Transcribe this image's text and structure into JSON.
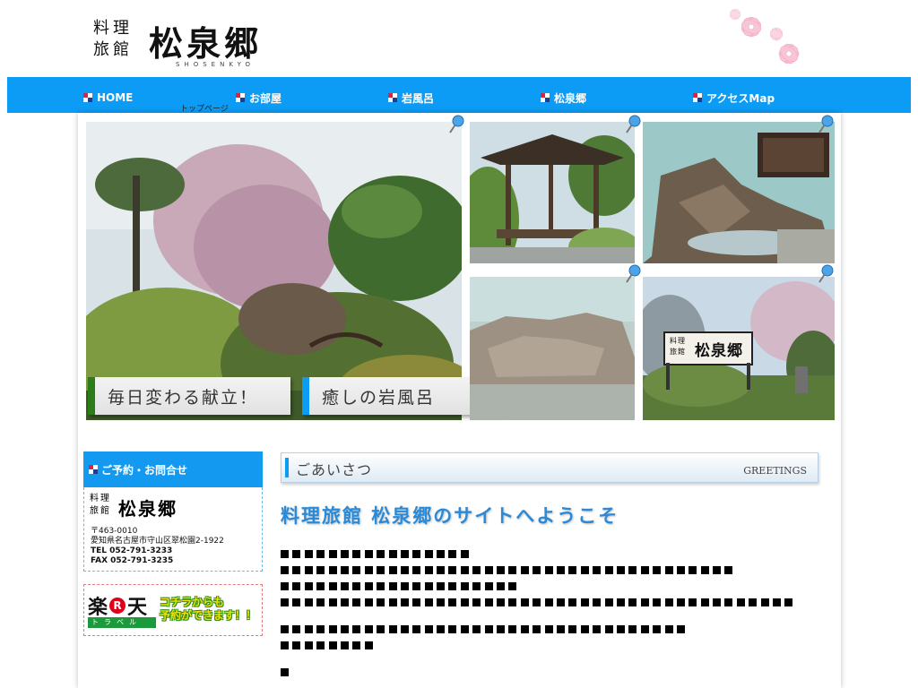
{
  "header": {
    "logo_small": "料理旅館",
    "logo_name": "松泉郷",
    "logo_roman": "SHOSENKYO"
  },
  "nav": {
    "items": [
      {
        "label": "HOME",
        "sub": "トップページ"
      },
      {
        "label": "お部屋"
      },
      {
        "label": "岩風呂"
      },
      {
        "label": "松泉郷"
      },
      {
        "label": "アクセスMap"
      }
    ]
  },
  "gallery": {
    "captions": [
      "毎日変わる献立！",
      "癒しの岩風呂"
    ],
    "caption_colors": [
      "#2c7d1a",
      "#0d9cf5"
    ],
    "sign_text": {
      "small": "料理旅館",
      "name": "松泉郷"
    }
  },
  "sidebar": {
    "heading": "ご予約・お問合せ",
    "logo_small": "料理旅館",
    "logo_name": "松泉郷",
    "postal": "〒463-0010",
    "address": "愛知県名古屋市守山区翠松園2-1922",
    "tel": "TEL  052-791-3233",
    "fax": "FAX  052-791-3235",
    "rakuten": {
      "brand_left": "楽",
      "brand_mark": "R",
      "brand_right": "天",
      "brand_sub": "トラベル",
      "line1": "コチラからも",
      "line2": "予約ができます！！"
    }
  },
  "greetings": {
    "title": "ごあいさつ",
    "title_en": "GREETINGS",
    "welcome": "料理旅館 松泉郷のサイトへようこそ",
    "censored_lines": [
      16,
      38,
      20,
      43,
      34,
      8,
      1
    ]
  },
  "colors": {
    "nav_blue": "#0d9cf5",
    "welcome_blue": "#2a8ad8"
  }
}
